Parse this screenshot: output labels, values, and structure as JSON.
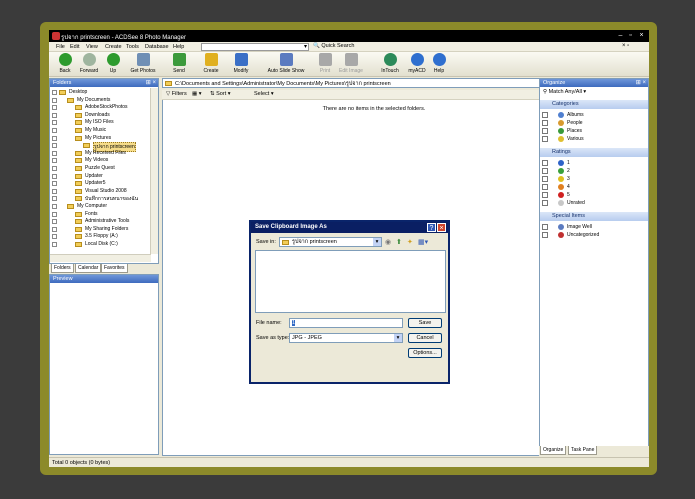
{
  "window": {
    "title": "รูปจาก printscreen - ACDSee 8 Photo Manager"
  },
  "menu": [
    "File",
    "Edit",
    "View",
    "Create",
    "Tools",
    "Database",
    "Help"
  ],
  "search": {
    "label": "Quick Search",
    "value": ""
  },
  "toolbar": [
    {
      "label": "Back",
      "icon": "back-arrow-icon",
      "color": "#2e9b2e"
    },
    {
      "label": "Forward",
      "icon": "forward-arrow-icon",
      "color": "#9fb59f"
    },
    {
      "label": "Up",
      "icon": "up-arrow-icon",
      "color": "#2e9b2e"
    },
    {
      "label": "Get Photos",
      "icon": "camera-icon",
      "color": "#6f8fb5"
    },
    {
      "label": "Send",
      "icon": "send-icon",
      "color": "#3c9a3c"
    },
    {
      "label": "Create",
      "icon": "create-wand-icon",
      "color": "#e0b020"
    },
    {
      "label": "Modify",
      "icon": "modify-icon",
      "color": "#3a6fc6"
    },
    {
      "label": "Auto Slide Show",
      "icon": "slideshow-icon",
      "color": "#5b7bc0"
    },
    {
      "label": "Print",
      "icon": "print-icon",
      "color": "#a8a8a8"
    },
    {
      "label": "Edit Image",
      "icon": "edit-image-icon",
      "color": "#a8a8a8"
    },
    {
      "label": "InTouch",
      "icon": "intouch-icon",
      "color": "#2c8a5a"
    },
    {
      "label": "myACD",
      "icon": "myacd-icon",
      "color": "#2f6fcf"
    },
    {
      "label": "Help",
      "icon": "help-icon",
      "color": "#2f6fcf"
    }
  ],
  "folders": {
    "title": "Folders",
    "items": [
      {
        "label": "Desktop",
        "level": 0,
        "checked": false
      },
      {
        "label": "My Documents",
        "level": 1,
        "checked": false
      },
      {
        "label": "AdobeStockPhotos",
        "level": 2,
        "checked": false
      },
      {
        "label": "Downloads",
        "level": 2,
        "checked": false
      },
      {
        "label": "My ISO Files",
        "level": 2,
        "checked": false
      },
      {
        "label": "My Music",
        "level": 2,
        "checked": false
      },
      {
        "label": "My Pictures",
        "level": 2,
        "checked": false
      },
      {
        "label": "รูปจาก printscreen",
        "level": 3,
        "checked": false,
        "selected": true
      },
      {
        "label": "My Received Files",
        "level": 2,
        "checked": false
      },
      {
        "label": "My Videos",
        "level": 2,
        "checked": false
      },
      {
        "label": "Puzzle Quest",
        "level": 2,
        "checked": false
      },
      {
        "label": "Updater",
        "level": 2,
        "checked": false
      },
      {
        "label": "Updater5",
        "level": 2,
        "checked": false
      },
      {
        "label": "Visual Studio 2008",
        "level": 2,
        "checked": false
      },
      {
        "label": "บันทึกการสนทนาของฉัน",
        "level": 2,
        "checked": false
      },
      {
        "label": "My Computer",
        "level": 1,
        "checked": false
      },
      {
        "label": "Fonts",
        "level": 2,
        "checked": false
      },
      {
        "label": "Administrative Tools",
        "level": 2,
        "checked": false
      },
      {
        "label": "My Sharing Folders",
        "level": 2,
        "checked": false
      },
      {
        "label": "3.5 Floppy (A:)",
        "level": 2,
        "checked": false
      },
      {
        "label": "Local Disk (C:)",
        "level": 2,
        "checked": false
      }
    ],
    "tabs": [
      "Folders",
      "Calendar",
      "Favorites"
    ]
  },
  "preview": {
    "title": "Preview"
  },
  "address": "C:\\Documents and Settings\\Administrator\\My Documents\\My Pictures\\รูปจาก printscreen",
  "filterbar": {
    "filters": "Filters",
    "sort": "Sort",
    "select": "Select"
  },
  "filelist": {
    "empty_message": "There are no items in the selected folders."
  },
  "organize": {
    "title": "Organize",
    "match": "Match Any/All",
    "sections": [
      {
        "title": "Categories",
        "items": [
          {
            "label": "Albums",
            "color": "#4f7fd0"
          },
          {
            "label": "People",
            "color": "#d89a2f"
          },
          {
            "label": "Places",
            "color": "#3a9a3a"
          },
          {
            "label": "Various",
            "color": "#e0c030"
          }
        ]
      },
      {
        "title": "Ratings",
        "items": [
          {
            "label": "1",
            "color": "#2d62c8"
          },
          {
            "label": "2",
            "color": "#3aa03a"
          },
          {
            "label": "3",
            "color": "#e0c020"
          },
          {
            "label": "4",
            "color": "#e08020"
          },
          {
            "label": "5",
            "color": "#d02020"
          },
          {
            "label": "Unrated",
            "color": "#c8c8c8"
          }
        ]
      },
      {
        "title": "Special Items",
        "items": [
          {
            "label": "Image Well",
            "color": "#5b7bc0"
          },
          {
            "label": "Uncategorized",
            "color": "#c03030"
          }
        ]
      }
    ],
    "tabs": [
      "Organize",
      "Task Pane"
    ]
  },
  "status": {
    "text": "Total 0 objects  (0 bytes)"
  },
  "dialog": {
    "title": "Save Clipboard Image As",
    "save_in_label": "Save in:",
    "save_in_value": "รูปจาก printscreen",
    "file_name_label": "File name:",
    "file_name_value": "1",
    "save_as_type_label": "Save as type:",
    "save_as_type_value": "JPG - JPEG",
    "save_button": "Save",
    "cancel_button": "Cancel",
    "options_button": "Options..."
  }
}
